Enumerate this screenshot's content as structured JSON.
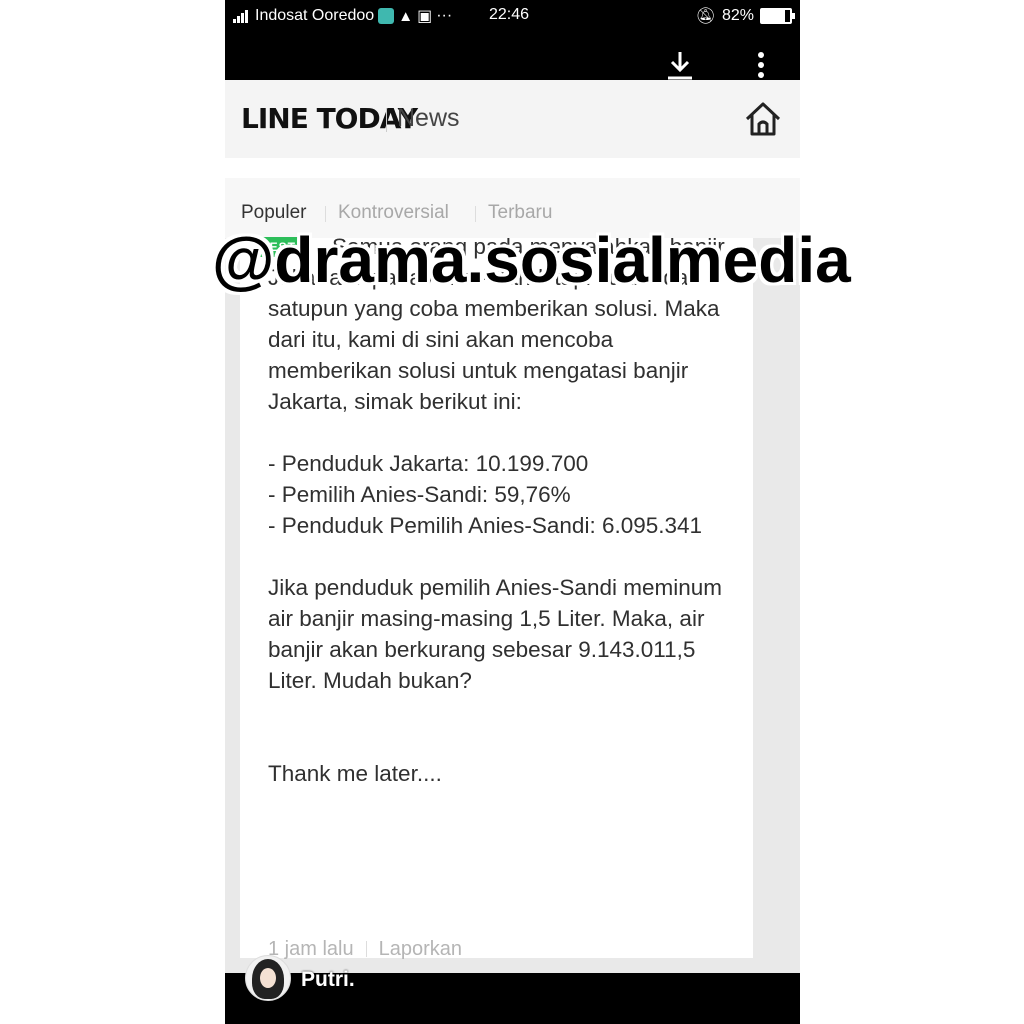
{
  "status_bar": {
    "carrier": "Indosat Ooredoo",
    "time": "22:46",
    "battery": "82%",
    "battery_level": 0.82,
    "icons": [
      "signal-icon",
      "chat-notification-icon",
      "warning-icon",
      "image-icon",
      "more-dots-icon",
      "mute-icon",
      "battery-icon"
    ]
  },
  "toolbar": {
    "icons": [
      "download-icon",
      "more-vertical-icon"
    ]
  },
  "header": {
    "brand": "LINE TODAY",
    "section": "News",
    "home_icon": "home-icon"
  },
  "tabs": [
    {
      "label": "Populer",
      "active": true
    },
    {
      "label": "Kontroversial",
      "active": false
    },
    {
      "label": "Terbaru",
      "active": false
    }
  ],
  "comment": {
    "badge": "BEST",
    "paragraph_1": "Semua orang pada menyalahkan banjir Jakarta kepada Anies-Sandi tapi tidak ada satupun yang coba memberikan solusi. Maka dari itu, kami di sini akan mencoba memberikan solusi untuk mengatasi banjir Jakarta, simak berikut ini:",
    "list": [
      "- Penduduk Jakarta: 10.199.700",
      "- Pemilih Anies-Sandi: 59,76%",
      "- Penduduk Pemilih Anies-Sandi: 6.095.341"
    ],
    "paragraph_2": "Jika penduduk pemilih Anies-Sandi meminum air banjir masing-masing 1,5 Liter. Maka, air banjir akan berkurang sebesar 9.143.011,5 Liter. Mudah bukan?",
    "closing": "Thank me later....",
    "time_ago": "1 jam lalu",
    "report": "Laporkan"
  },
  "next_comment": {
    "username": "Putri."
  },
  "watermark": "@drama.sosialmedia",
  "colors": {
    "badge_green": "#2dbe5a",
    "text": "#303030",
    "muted": "#b5b5b5"
  }
}
